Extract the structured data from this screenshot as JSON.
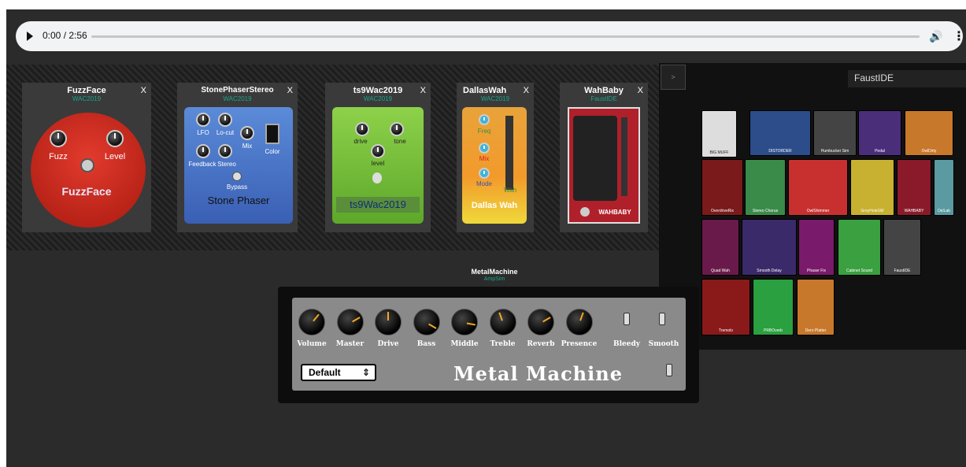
{
  "player": {
    "time": "0:00 / 2:56",
    "progress": 0
  },
  "pedals": [
    {
      "title": "FuzzFace",
      "subtitle": "WAC2019",
      "close": "X",
      "knob1": "Fuzz",
      "knob2": "Level",
      "name": "FuzzFace"
    },
    {
      "title": "StonePhaserStereo",
      "subtitle": "WAC2019",
      "close": "X",
      "labels": [
        "LFO",
        "Lo-cut",
        "Mix",
        "Feedback",
        "Stereo",
        "Color",
        "Bypass"
      ],
      "name": "Stone Phaser"
    },
    {
      "title": "ts9Wac2019",
      "subtitle": "WAC2019",
      "close": "X",
      "labels": [
        "drive",
        "tone",
        "level"
      ],
      "name": "ts9Wac2019"
    },
    {
      "title": "DallasWah",
      "subtitle": "WAC2019",
      "close": "X",
      "labels": [
        "Freq",
        "Mix",
        "Mode",
        "Wah"
      ],
      "name": "Dallas Wah"
    },
    {
      "title": "WahBaby",
      "subtitle": "FaustIDE",
      "close": "X",
      "name": "WAHBABY"
    }
  ],
  "side": {
    "toggle": ">",
    "faust": "FaustIDE",
    "thumbs": [
      "BIG MUFF",
      "DISTORDER",
      "Humbucker Sim",
      "Pedal",
      "OwlDirty",
      "OverdriveRix",
      "Stereo Chorus",
      "OwlShimmer",
      "GreyHoleSW",
      "WAHBABY",
      "DelLab",
      "Quad Wah",
      "Smooth Delay",
      "Phaser Fix",
      "Cabinet Sound",
      "FaustIDE",
      "Tremolo",
      "PRBOverb",
      "Dero Platter"
    ]
  },
  "amp": {
    "title": "MetalMachine",
    "subtitle": "AmpSim",
    "knobs": [
      "Volume",
      "Master",
      "Drive",
      "Bass",
      "Middle",
      "Treble",
      "Reverb",
      "Presence"
    ],
    "switches": [
      "Bleedy",
      "Smooth"
    ],
    "preset": "Default",
    "brand": "Metal Machine"
  }
}
